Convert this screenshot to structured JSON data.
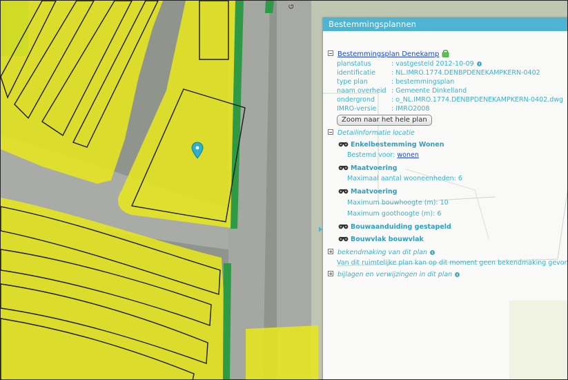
{
  "map": {
    "street_label": "G",
    "marker": "map-pin-icon"
  },
  "panel": {
    "title": "Bestemmingsplannen",
    "plan_link": "Bestemmingsplan Denekamp",
    "lock_icon": "lock-icon",
    "fields": [
      {
        "key": "planstatus",
        "value": ": vastgesteld 2012-10-09",
        "info": true
      },
      {
        "key": "identificatie",
        "value": ": NL.IMRO.1774.DENBPDENEKAMPKERN-0402"
      },
      {
        "key": "type plan",
        "value": ": bestemmingsplan"
      },
      {
        "key": "naam overheid",
        "value": ": Gemeente Dinkelland"
      },
      {
        "key": "ondergrond",
        "value": ": o_NL.IMRO.1774.DENBPDENEKAMPKERN-0402.dwg"
      },
      {
        "key": "IMRO-versie",
        "value": ": IMRO2008"
      }
    ],
    "zoom_button": "Zoom naar het hele plan",
    "detail_section": "Detailinformatie locatie",
    "detail": {
      "enkelbestemming": "Enkelbestemming Wonen",
      "bestemd_voor_label": "Bestemd voor: ",
      "bestemd_voor_value": "wonen",
      "maatvoering1": "Maatvoering",
      "maatvoering1_line": "Maximaal aantal wooneenheden: 6",
      "maatvoering2": "Maatvoering",
      "maatvoering2_line1": "Maximum bouwhoogte (m): 10",
      "maatvoering2_line2": "Maximum goothoogte (m): 6",
      "bouwaanduiding": "Bouwaanduiding gestapeld",
      "bouwvlak": "Bouwvlak bouwvlak"
    },
    "bekendmaking_section": "bekendmaking van dit plan",
    "bekendmaking_text": "Van dit ruimtelijke plan kan op dit moment geen bekendmaking gevonden worden",
    "bijlagen_section": "bijlagen en verwijzingen in dit plan"
  }
}
